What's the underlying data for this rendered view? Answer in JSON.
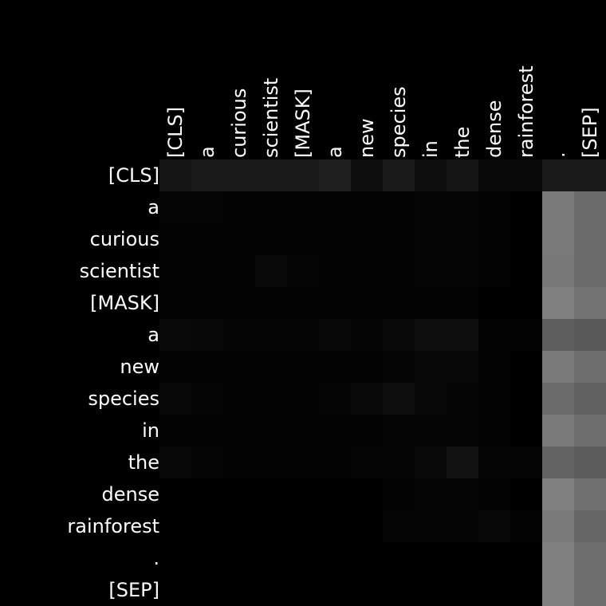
{
  "chart_data": {
    "type": "heatmap",
    "title": "",
    "xlabel": "",
    "ylabel": "",
    "colormap": "grayscale",
    "background": "#000000",
    "text_color": "#ffffff",
    "value_range": [
      0,
      1
    ],
    "x_tokens": [
      "[CLS]",
      "a",
      "curious",
      "scientist",
      "[MASK]",
      "a",
      "new",
      "species",
      "in",
      "the",
      "dense",
      "rainforest",
      ".",
      "[SEP]"
    ],
    "y_tokens": [
      "[CLS]",
      "a",
      "curious",
      "scientist",
      "[MASK]",
      "a",
      "new",
      "species",
      "in",
      "the",
      "dense",
      "rainforest",
      ".",
      "[SEP]"
    ],
    "values": [
      [
        0.08,
        0.1,
        0.1,
        0.1,
        0.1,
        0.12,
        0.06,
        0.1,
        0.06,
        0.08,
        0.04,
        0.04,
        0.1,
        0.1
      ],
      [
        0.02,
        0.02,
        0.01,
        0.01,
        0.01,
        0.01,
        0.01,
        0.01,
        0.02,
        0.02,
        0.01,
        0.0,
        0.48,
        0.42
      ],
      [
        0.01,
        0.01,
        0.01,
        0.01,
        0.01,
        0.01,
        0.01,
        0.01,
        0.02,
        0.02,
        0.01,
        0.0,
        0.48,
        0.42
      ],
      [
        0.01,
        0.01,
        0.01,
        0.04,
        0.02,
        0.01,
        0.01,
        0.01,
        0.02,
        0.02,
        0.01,
        0.0,
        0.47,
        0.42
      ],
      [
        0.01,
        0.01,
        0.01,
        0.01,
        0.01,
        0.01,
        0.01,
        0.01,
        0.01,
        0.01,
        0.0,
        0.0,
        0.5,
        0.45
      ],
      [
        0.04,
        0.03,
        0.02,
        0.02,
        0.02,
        0.03,
        0.02,
        0.04,
        0.06,
        0.06,
        0.01,
        0.01,
        0.37,
        0.35
      ],
      [
        0.01,
        0.01,
        0.01,
        0.01,
        0.01,
        0.01,
        0.01,
        0.02,
        0.03,
        0.03,
        0.01,
        0.0,
        0.48,
        0.43
      ],
      [
        0.03,
        0.02,
        0.01,
        0.01,
        0.01,
        0.02,
        0.04,
        0.06,
        0.03,
        0.02,
        0.01,
        0.0,
        0.42,
        0.38
      ],
      [
        0.01,
        0.01,
        0.01,
        0.01,
        0.01,
        0.01,
        0.01,
        0.02,
        0.02,
        0.02,
        0.01,
        0.0,
        0.48,
        0.43
      ],
      [
        0.03,
        0.02,
        0.01,
        0.01,
        0.01,
        0.01,
        0.02,
        0.02,
        0.04,
        0.07,
        0.02,
        0.02,
        0.39,
        0.36
      ],
      [
        0.0,
        0.0,
        0.0,
        0.0,
        0.0,
        0.0,
        0.0,
        0.01,
        0.02,
        0.02,
        0.01,
        0.0,
        0.5,
        0.44
      ],
      [
        0.0,
        0.0,
        0.0,
        0.0,
        0.0,
        0.0,
        0.0,
        0.02,
        0.02,
        0.02,
        0.03,
        0.01,
        0.48,
        0.4
      ],
      [
        0.0,
        0.0,
        0.0,
        0.0,
        0.0,
        0.0,
        0.0,
        0.0,
        0.0,
        0.0,
        0.0,
        0.0,
        0.5,
        0.43
      ],
      [
        0.0,
        0.0,
        0.0,
        0.0,
        0.0,
        0.0,
        0.0,
        0.0,
        0.0,
        0.0,
        0.0,
        0.0,
        0.5,
        0.43
      ]
    ]
  }
}
